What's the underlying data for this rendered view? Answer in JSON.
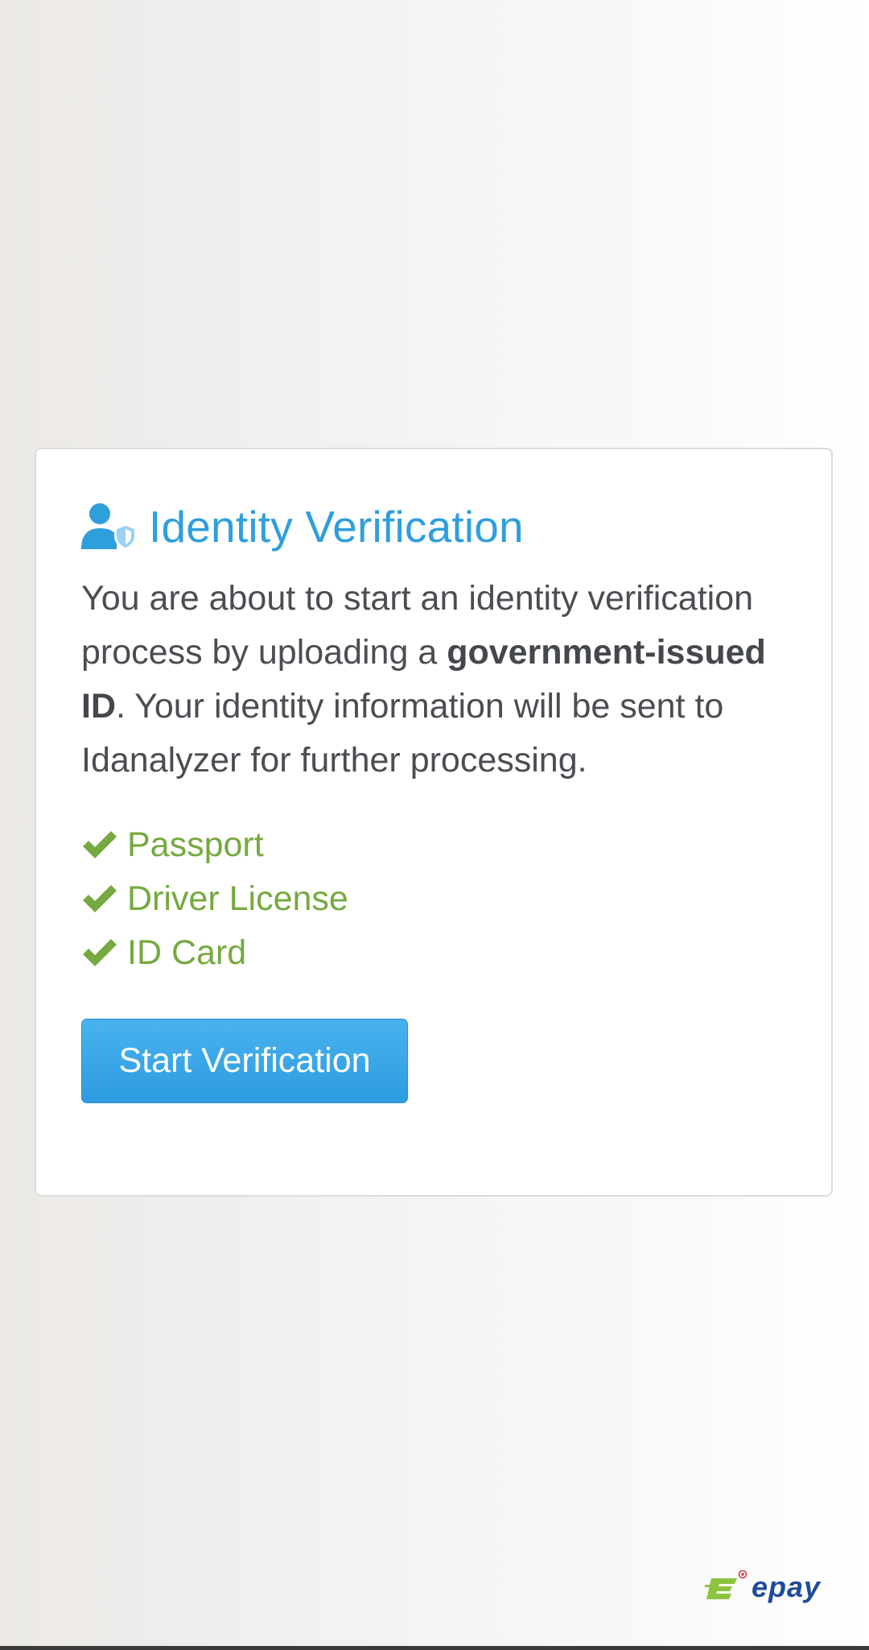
{
  "card": {
    "title": "Identity Verification",
    "title_icon": "user-shield-icon",
    "description": {
      "part1": "You are about to start an identity verification process by uploading a ",
      "bold": "government-issued ID",
      "part2": ". Your identity information will be sent to Idanalyzer for further processing."
    },
    "documents": [
      {
        "label": "Passport",
        "icon": "check-icon"
      },
      {
        "label": "Driver License",
        "icon": "check-icon"
      },
      {
        "label": "ID Card",
        "icon": "check-icon"
      }
    ],
    "start_button_label": "Start Verification"
  },
  "brand": {
    "name": "epay",
    "logo_icon": "epay-logo-icon"
  },
  "colors": {
    "title_blue": "#2f9fdc",
    "check_green": "#76a93f",
    "button_blue": "#2d9be0",
    "brand_blue": "#1f4b9a",
    "brand_green": "#8cc43f"
  }
}
